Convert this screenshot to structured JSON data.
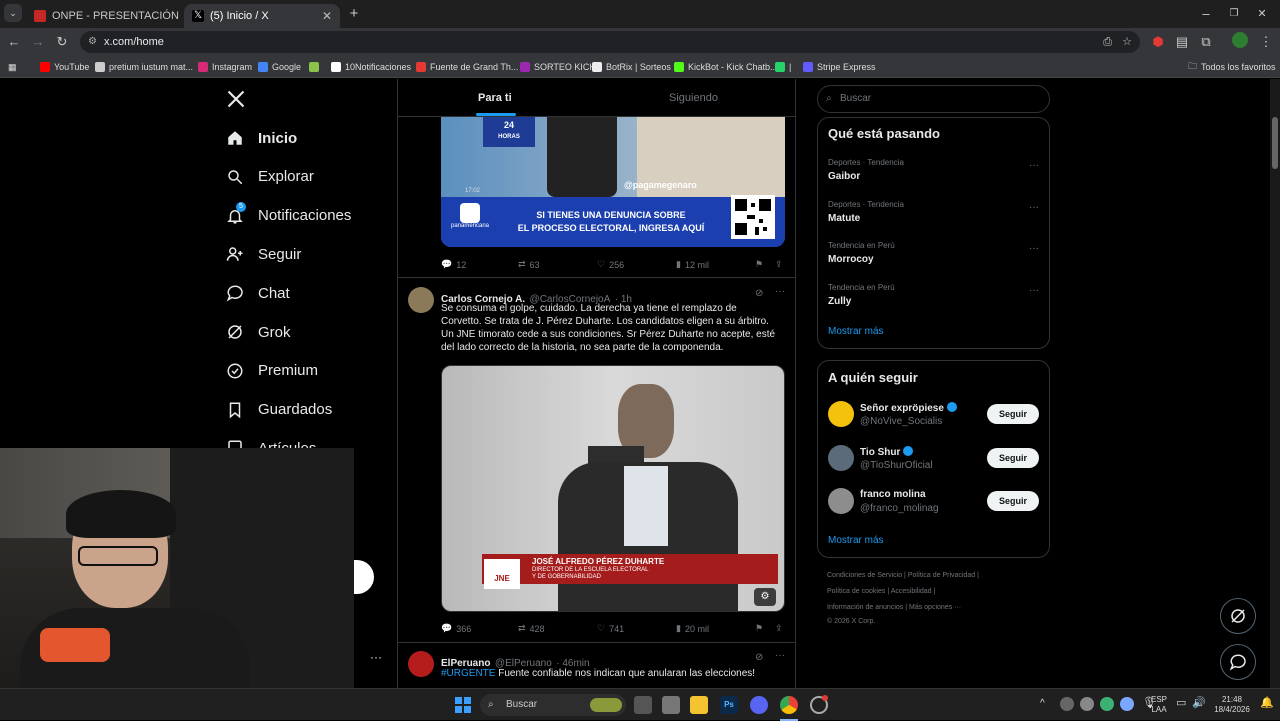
{
  "browser": {
    "tabs": [
      {
        "label": "ONPE - PRESENTACIÓN DE RES",
        "active": false,
        "color": "#c62828"
      },
      {
        "label": "(5) Inicio / X",
        "active": true,
        "color": "#ffffff"
      }
    ],
    "url": "x.com/home",
    "bookmarks": [
      {
        "label": "YouTube",
        "color": "#ff0000"
      },
      {
        "label": "pretium iustum mat...",
        "color": "#cccccc"
      },
      {
        "label": "Instagram",
        "color": "#d62976"
      },
      {
        "label": "Google",
        "color": "#4285f4"
      },
      {
        "label": "",
        "color": "#8bc34a"
      },
      {
        "label": "10Notificaciones",
        "color": "#ffffff"
      },
      {
        "label": "Fuente de Grand Th...",
        "color": "#e53935"
      },
      {
        "label": "SORTEO KICK",
        "color": "#9c27b0"
      },
      {
        "label": "BotRix | Sorteos",
        "color": "#eeeeee"
      },
      {
        "label": "KickBot - Kick Chatb...",
        "color": "#53fc18"
      },
      {
        "label": "|",
        "color": "#25d366"
      },
      {
        "label": "Stripe Express",
        "color": "#635bff"
      }
    ],
    "all_bookmarks": "Todos los favoritos",
    "notification_badge": "5"
  },
  "sidebar": {
    "items": [
      {
        "label": "Inicio",
        "icon": "home-icon"
      },
      {
        "label": "Explorar",
        "icon": "search-icon"
      },
      {
        "label": "Notificaciones",
        "icon": "bell-icon"
      },
      {
        "label": "Seguir",
        "icon": "person-plus-icon"
      },
      {
        "label": "Chat",
        "icon": "chat-icon"
      },
      {
        "label": "Grok",
        "icon": "grok-icon"
      },
      {
        "label": "Premium",
        "icon": "premium-icon"
      },
      {
        "label": "Guardados",
        "icon": "bookmark-icon"
      },
      {
        "label": "Artículos",
        "icon": "articles-icon"
      }
    ]
  },
  "feed": {
    "tabs": [
      "Para ti",
      "Siguiendo"
    ],
    "tweet1": {
      "image_banner_line1": "SI TIENES UNA DENUNCIA SOBRE",
      "image_banner_line2": "EL PROCESO ELECTORAL, INGRESA AQUÍ",
      "image_handle": "@pagamegenaro",
      "image_channel": "panamericana",
      "image_logo_24": "24",
      "image_logo_horas": "HORAS",
      "image_bug": "17:02",
      "replies": "12",
      "reposts": "63",
      "likes": "256",
      "views": "12 mil"
    },
    "tweet2": {
      "name": "Carlos Cornejo A.",
      "handle": "@CarlosCornejoA",
      "time": "· 1h",
      "text_lines": [
        "Se consuma el golpe, cuidado.  La derecha ya tiene el remplazo de",
        "Corvetto. Se trata de J. Pérez Duharte. Los candidatos eligen a su árbitro.",
        "Un JNE timorato cede a sus condiciones. Sr Pérez Duharte no acepte, esté",
        "del lado correcto de la historia, no sea parte de la componenda."
      ],
      "caption_name": "JOSÉ ALFREDO PÉREZ DUHARTE",
      "caption_role1": "DIRECTOR DE LA ESCUELA ELECTORAL",
      "caption_role2": "Y DE GOBERNABILIDAD",
      "logo": "JNE",
      "replies": "366",
      "reposts": "428",
      "likes": "741",
      "views": "20 mil"
    },
    "tweet3": {
      "name": "ElPeruano",
      "handle": "@ElPeruano",
      "time": "· 46min",
      "hashtag": "#URGENTE",
      "text": " Fuente confiable nos indican que anularan las elecciones!"
    }
  },
  "right": {
    "search_placeholder": "Buscar",
    "trends_title": "Qué está pasando",
    "trends": [
      {
        "meta": "Deportes · Tendencia",
        "topic": "Gaibor"
      },
      {
        "meta": "Deportes · Tendencia",
        "topic": "Matute"
      },
      {
        "meta": "Tendencia en Perú",
        "topic": "Morrocoy"
      },
      {
        "meta": "Tendencia en Perú",
        "topic": "Zully"
      }
    ],
    "show_more": "Mostrar más",
    "follow_title": "A quién seguir",
    "follows": [
      {
        "name": "Señor expröpiese",
        "handle": "@NoVive_Socialis",
        "button": "Seguir",
        "verified": true,
        "color": "#f4c20d"
      },
      {
        "name": "Tio Shur",
        "handle": "@TioShurOficial",
        "button": "Seguir",
        "verified": true,
        "color": "#5b6b7a"
      },
      {
        "name": "franco molina",
        "handle": "@franco_molinag",
        "button": "Seguir",
        "verified": false,
        "color": "#8d8d8d"
      }
    ],
    "show_more2": "Mostrar más",
    "footer": {
      "l1a": "Condiciones de Servicio",
      "l1b": "Política de Privacidad",
      "l2a": "Política de cookies",
      "l2b": "Accesibilidad",
      "l3a": "Información de anuncios",
      "l3b": "Más opciones ···",
      "l4": "© 2026 X Corp."
    }
  },
  "taskbar": {
    "search": "Buscar",
    "lang1": "ESP",
    "lang2": "LAA",
    "time": "21:48",
    "date": "18/4/2026"
  },
  "colors": {
    "accent": "#1d9bf0",
    "verified": "#1d9bf0",
    "caption_red": "#a51c1c"
  }
}
